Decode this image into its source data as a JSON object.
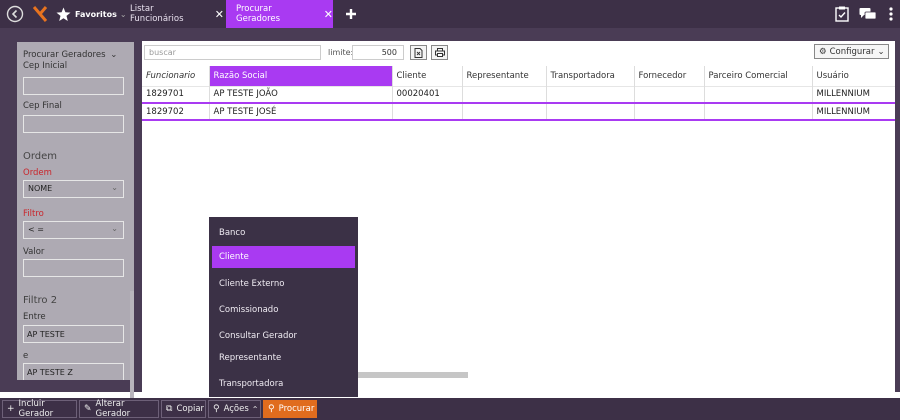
{
  "topbar": {
    "favoritos_label": "Favoritos",
    "tabs": [
      {
        "label": "Listar Funcionários"
      },
      {
        "label": "Procurar Geradores"
      }
    ]
  },
  "filter": {
    "header": "Procurar Geradores",
    "cep_inicial_label": "Cep Inicial",
    "cep_final_label": "Cep Final",
    "ordem_section": "Ordem",
    "ordem_label": "Ordem",
    "ordem_value": "NOME",
    "filtro_label": "Filtro",
    "filtro_value": "< =",
    "valor_label": "Valor",
    "filtro2_section": "Filtro 2",
    "entre_label": "Entre",
    "entre_value": "AP TESTE",
    "e_label": "e",
    "e_value": "AP TESTE Z"
  },
  "toolbar": {
    "search_placeholder": "buscar",
    "limite_label": "limite:",
    "limite_value": "500",
    "configurar_label": "Configurar"
  },
  "table": {
    "columns": [
      "Funcionario",
      "Razão Social",
      "Cliente",
      "Representante",
      "Transportadora",
      "Fornecedor",
      "Parceiro Comercial",
      "Usuário"
    ],
    "rows": [
      [
        "1829701",
        "AP TESTE JOÃO",
        "00020401",
        "",
        "",
        "",
        "",
        "MILLENNIUM"
      ],
      [
        "1829702",
        "AP TESTE JOSÉ",
        "",
        "",
        "",
        "",
        "",
        "MILLENNIUM"
      ]
    ]
  },
  "dropdown": {
    "items": [
      "Banco",
      "Cliente",
      "Cliente Externo",
      "Comissionado",
      "Consultar Gerador",
      "Representante",
      "Transportadora"
    ]
  },
  "bottombar": {
    "incluir": "Incluir Gerador",
    "alterar": "Alterar Gerador",
    "copiar": "Copiar",
    "acoes": "Ações",
    "procurar": "Procurar"
  },
  "colors": {
    "accent": "#a93af2",
    "chrome": "#3d3047",
    "procurar": "#e06c1e"
  }
}
